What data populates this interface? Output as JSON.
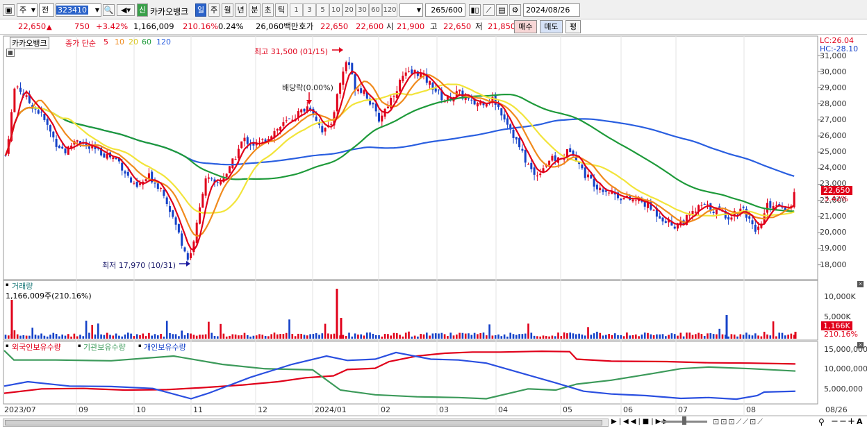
{
  "toolbar": {
    "market": "주",
    "prev_label": "전",
    "code": "323410",
    "new_badge": "신",
    "name": "카카오뱅크",
    "periods": [
      "일",
      "주",
      "월",
      "년",
      "분",
      "초",
      "틱"
    ],
    "selected_period": "일",
    "numbers": [
      "1",
      "3",
      "5",
      "10",
      "20",
      "30",
      "60",
      "120"
    ],
    "count": "265",
    "count_total": "/600",
    "date": "2024/08/26"
  },
  "quote": {
    "price": "22,650",
    "change": "750",
    "change_pct": "+3.42%",
    "volume": "1,166,009",
    "volume_ratio": "210.16%",
    "turnover": "0.24%",
    "amount": "26,060백만",
    "hoga_label": "호가",
    "ask": "22,650",
    "bid": "22,600",
    "open_label": "시",
    "open": "21,900",
    "high_label": "고",
    "high": "22,650",
    "low_label": "저",
    "low": "21,850",
    "buy_label": "매수",
    "sell_label": "매도",
    "eval_label": "평"
  },
  "chart": {
    "stock_tag": "카카오뱅크",
    "legend_prefix": "종가 단순",
    "ma_labels": [
      "5",
      "10",
      "20",
      "60",
      "120"
    ],
    "lc": "LC:26.04",
    "hc": "HC:-28.10",
    "high_note": "최고 31,500 (01/15)",
    "low_note": "최저 17,970 (10/31)",
    "dividend_note": "배당락(0.00%)",
    "last_price_tag": "22,650",
    "last_pct_tag": "3.42%",
    "y_ticks": [
      "31,000",
      "30,000",
      "29,000",
      "28,000",
      "27,000",
      "26,000",
      "25,000",
      "24,000",
      "23,000",
      "22,000",
      "21,000",
      "20,000",
      "19,000",
      "18,000"
    ],
    "volume_title": "거래량",
    "volume_note": "1,166,009주(210.16%)",
    "volume_ticks": [
      "10,000K",
      "5,000K"
    ],
    "volume_tag": "1,166K",
    "volume_pct_tag": "210.16%",
    "holdings_legend": [
      "외국인보유수량",
      "기관보유수량",
      "개인보유수량"
    ],
    "holdings_ticks": [
      "15,000,000",
      "10,000,000",
      "5,000,000"
    ],
    "x_labels": [
      "2023/07",
      "09",
      "10",
      "11",
      "12",
      "2024/01",
      "02",
      "03",
      "04",
      "05",
      "06",
      "07",
      "08"
    ],
    "x_last": "08/26"
  },
  "colors": {
    "up": "#e0001a",
    "down": "#1542c8",
    "ma5": "#e0001a",
    "ma10": "#f08a1c",
    "ma20": "#f2e43a",
    "ma60": "#1e9a3a",
    "ma120": "#2a5fe0",
    "foreign": "#e0001a",
    "institution": "#3c9a5a",
    "individual": "#2a4fe0"
  },
  "icons": [
    "chart-type-icon",
    "search-icon",
    "speaker-icon",
    "candle-icon",
    "drawing-icon",
    "save-icon",
    "gear-icon"
  ]
}
